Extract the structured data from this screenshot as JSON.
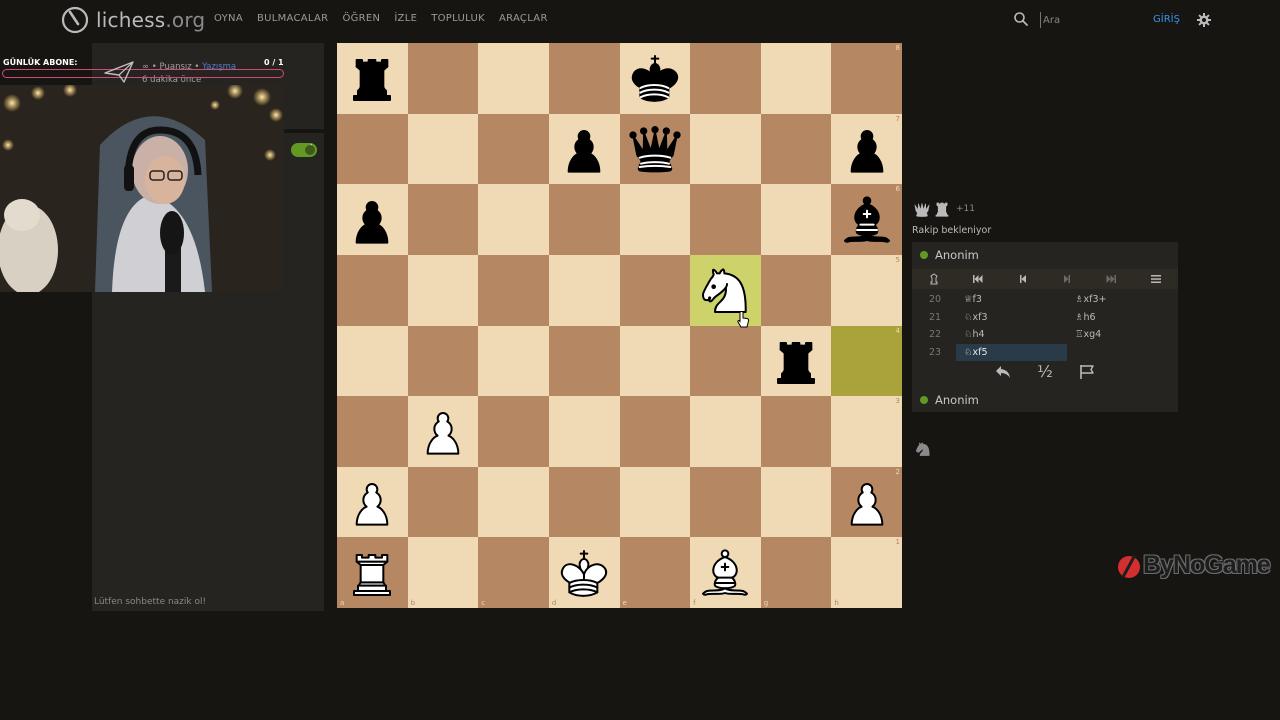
{
  "header": {
    "logo_name": "lichess",
    "logo_tld": ".org",
    "nav": [
      "OYNA",
      "BULMACALAR",
      "ÖĞREN",
      "İZLE",
      "TOPLULUK",
      "ARAÇLAR"
    ],
    "search_placeholder": "Ara",
    "login_label": "GİRİŞ"
  },
  "overlay": {
    "sub_label": "GÜNLÜK ABONE:",
    "sub_count": "0  / 1",
    "accent_color": "#d04a78"
  },
  "chat": {
    "line1_prefix": "∞ • Puansız • ",
    "line1_link": "Yazışma",
    "line2": "6 dakika önce",
    "placeholder": "Lütfen sohbette nazik ol!"
  },
  "board": {
    "files": [
      "a",
      "b",
      "c",
      "d",
      "e",
      "f",
      "g",
      "h"
    ],
    "ranks": [
      "8",
      "7",
      "6",
      "5",
      "4",
      "3",
      "2",
      "1"
    ],
    "highlight_color": "#cdd26a",
    "light_color": "#f0d9b5",
    "dark_color": "#b58863",
    "position": [
      [
        "bR",
        "",
        "",
        "",
        "bK",
        "",
        "",
        ""
      ],
      [
        "",
        "",
        "",
        "bP",
        "bQ",
        "",
        "",
        "bP"
      ],
      [
        "bP",
        "",
        "",
        "",
        "",
        "",
        "",
        "bB"
      ],
      [
        "",
        "",
        "",
        "",
        "",
        "wN",
        "",
        ""
      ],
      [
        "",
        "",
        "",
        "",
        "",
        "",
        "bR",
        ""
      ],
      [
        "",
        "wP",
        "",
        "",
        "",
        "",
        "",
        ""
      ],
      [
        "wP",
        "",
        "",
        "",
        "",
        "",
        "",
        "wP"
      ],
      [
        "wR",
        "",
        "",
        "wK",
        "",
        "wB",
        "",
        ""
      ]
    ],
    "last_move": [
      "h4",
      "f5"
    ]
  },
  "panel": {
    "material_plus": "+11",
    "waiting": "Rakip bekleniyor",
    "player_top": "Anonim",
    "player_bottom": "Anonim",
    "half_label": "½",
    "moves": [
      {
        "num": "20",
        "white": "♕f3",
        "black": "♗xf3+"
      },
      {
        "num": "21",
        "white": "♘xf3",
        "black": "♗h6"
      },
      {
        "num": "22",
        "white": "♘h4",
        "black": "♖xg4"
      },
      {
        "num": "23",
        "white": "♘xf5",
        "black": ""
      }
    ],
    "active_move": "23w"
  },
  "watermark": {
    "text": "ByNoGame",
    "color": "#d32f2f"
  }
}
